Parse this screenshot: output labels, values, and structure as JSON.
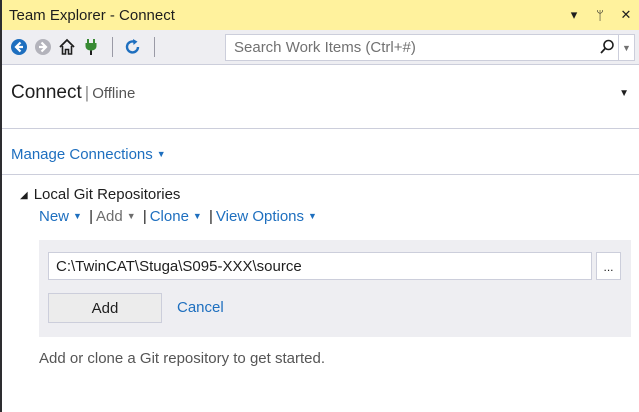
{
  "window": {
    "title": "Team Explorer - Connect",
    "controls": {
      "dropdown": "▾",
      "pin": "ᛘ",
      "close": "✕"
    }
  },
  "toolbar": {
    "icons": [
      "back-icon",
      "forward-icon",
      "home-icon",
      "connect-plug-icon",
      "refresh-icon"
    ],
    "search": {
      "placeholder": "Search Work Items (Ctrl+#)",
      "value": ""
    }
  },
  "header": {
    "title": "Connect",
    "separator": "|",
    "status": "Offline"
  },
  "manage_connections": "Manage Connections",
  "local_git": {
    "heading": "Local Git Repositories",
    "actions": {
      "new": "New",
      "add": "Add",
      "clone": "Clone",
      "view_options": "View Options",
      "separator": "|"
    },
    "add_panel": {
      "path_value": "C:\\TwinCAT\\Stuga\\S095-XXX\\source",
      "browse_label": "...",
      "add_button": "Add",
      "cancel_link": "Cancel"
    },
    "hint": "Add or clone a Git repository to get started."
  },
  "colors": {
    "title_bar": "#fff29d",
    "toolbar": "#eeeef2",
    "link": "#1e6fbf",
    "back_icon": "#1e6fbf",
    "plug_icon": "#388a34"
  }
}
